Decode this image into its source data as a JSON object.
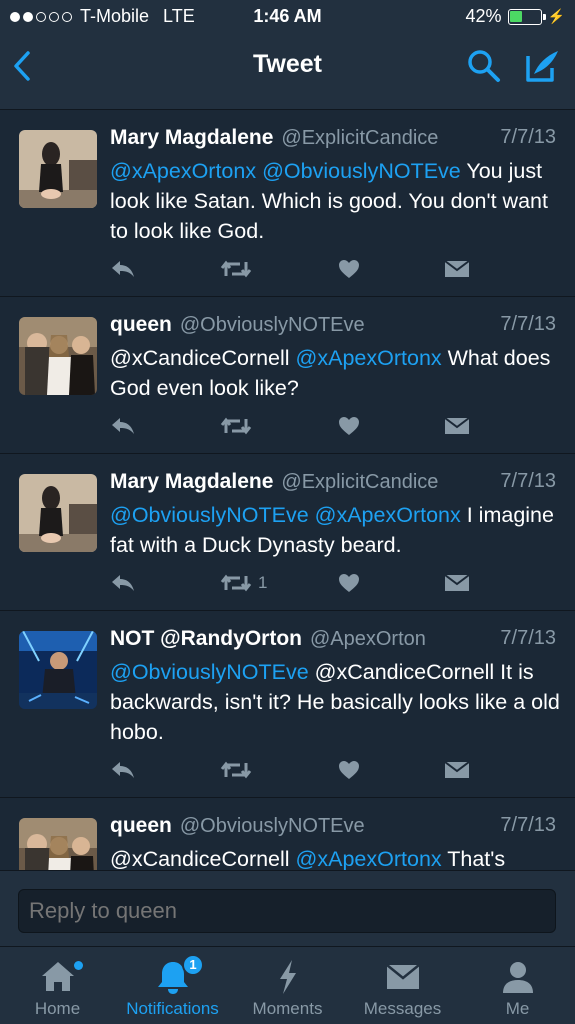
{
  "status_bar": {
    "carrier": "T-Mobile",
    "network": "LTE",
    "time": "1:46 AM",
    "battery": "42%",
    "battery_level": 0.42,
    "signal_bars_filled": 2,
    "signal_bars_total": 5
  },
  "nav": {
    "title": "Tweet",
    "back_icon": "chevron-left-icon",
    "search_icon": "search-icon",
    "compose_icon": "compose-tweet-icon"
  },
  "colors": {
    "background": "#1b2836",
    "bar": "#22303f",
    "accent": "#1da1f2",
    "muted": "#8899a6"
  },
  "tweets": [
    {
      "name": "Mary Magdalene",
      "handle": "@ExplicitCandice",
      "date": "7/7/13",
      "segments": [
        {
          "text": "@xApexOrtonx",
          "mention": true
        },
        {
          "text": " ",
          "mention": false
        },
        {
          "text": "@ObviouslyNOTEve",
          "mention": true
        },
        {
          "text": " You just look like Satan. Which is good. You don't want to look like God.",
          "mention": false
        }
      ],
      "retweet_count": ""
    },
    {
      "name": "queen",
      "handle": "@ObviouslyNOTEve",
      "date": "7/7/13",
      "segments": [
        {
          "text": "@xCandiceCornell ",
          "mention": false
        },
        {
          "text": "@xApexOrtonx",
          "mention": true
        },
        {
          "text": " What does God even look like?",
          "mention": false
        }
      ],
      "retweet_count": ""
    },
    {
      "name": "Mary Magdalene",
      "handle": "@ExplicitCandice",
      "date": "7/7/13",
      "segments": [
        {
          "text": "@ObviouslyNOTEve",
          "mention": true
        },
        {
          "text": " ",
          "mention": false
        },
        {
          "text": "@xApexOrtonx",
          "mention": true
        },
        {
          "text": " I imagine fat with a Duck Dynasty beard.",
          "mention": false
        }
      ],
      "retweet_count": "1"
    },
    {
      "name": "NOT @RandyOrton",
      "handle": "@ApexOrton",
      "date": "7/7/13",
      "segments": [
        {
          "text": "@ObviouslyNOTEve",
          "mention": true
        },
        {
          "text": " @xCandiceCornell It is backwards, isn't it? He basically looks like a old hobo.",
          "mention": false
        }
      ],
      "retweet_count": ""
    },
    {
      "name": "queen",
      "handle": "@ObviouslyNOTEve",
      "date": "7/7/13",
      "segments": [
        {
          "text": "@xCandiceCornell ",
          "mention": false
        },
        {
          "text": "@xApexOrtonx",
          "mention": true
        },
        {
          "text": " That's",
          "mention": false
        }
      ],
      "retweet_count": ""
    }
  ],
  "reply": {
    "placeholder": "Reply to queen"
  },
  "tabs": [
    {
      "label": "Home",
      "icon": "home-icon",
      "active": false,
      "dot": true
    },
    {
      "label": "Notifications",
      "icon": "bell-icon",
      "active": true,
      "badge": "1"
    },
    {
      "label": "Moments",
      "icon": "lightning-icon",
      "active": false
    },
    {
      "label": "Messages",
      "icon": "envelope-icon",
      "active": false
    },
    {
      "label": "Me",
      "icon": "person-icon",
      "active": false
    }
  ]
}
